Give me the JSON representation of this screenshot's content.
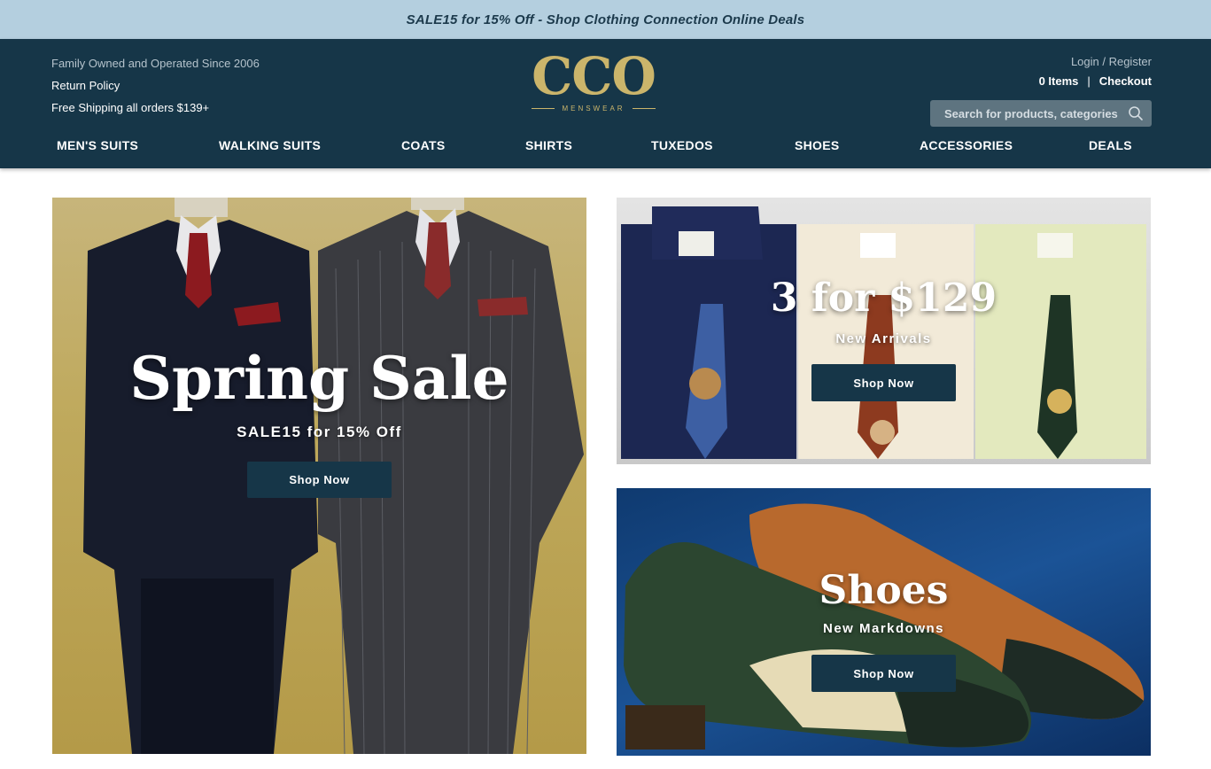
{
  "promo": {
    "text": "SALE15 for 15% Off - Shop Clothing Connection Online Deals"
  },
  "header": {
    "tagline": "Family Owned and Operated Since 2006",
    "return_policy": "Return Policy",
    "shipping": "Free Shipping all orders $139+",
    "logo": {
      "main": "CCO",
      "sub": "MENSWEAR"
    },
    "login": "Login / Register",
    "cart": "0 Items",
    "separator": "|",
    "checkout": "Checkout",
    "search_placeholder": "Search for products, categories"
  },
  "nav": [
    "MEN'S SUITS",
    "WALKING SUITS",
    "COATS",
    "SHIRTS",
    "TUXEDOS",
    "SHOES",
    "ACCESSORIES",
    "DEALS"
  ],
  "banners": {
    "hero": {
      "title": "Spring Sale",
      "subtitle": "SALE15 for 15% Off",
      "button": "Shop Now"
    },
    "shirts": {
      "title": "3 for $129",
      "subtitle": "New Arrivals",
      "button": "Shop Now"
    },
    "shoes": {
      "title": "Shoes",
      "subtitle": "New Markdowns",
      "button": "Shop Now"
    }
  },
  "colors": {
    "promo_bg": "#b4cfdf",
    "header_bg": "#163648",
    "logo_gold": "#cbb56b",
    "button_bg": "#163648"
  },
  "icons": {
    "search": "search-icon"
  }
}
